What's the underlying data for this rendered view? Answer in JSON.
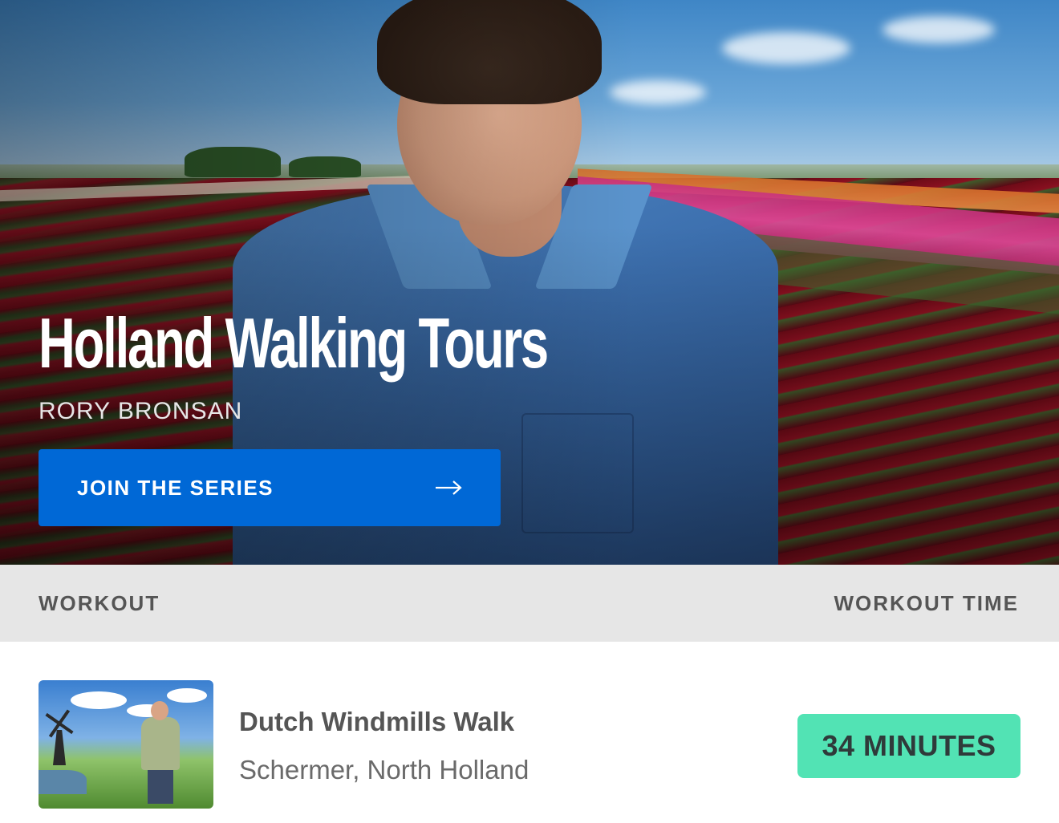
{
  "hero": {
    "title": "Holland Walking Tours",
    "author": "RORY BRONSAN",
    "cta_label": "JOIN THE SERIES",
    "cta_icon": "arrow-right-icon",
    "cta_color": "#0068d6"
  },
  "table": {
    "headers": {
      "workout": "WORKOUT",
      "workout_time": "WORKOUT TIME"
    },
    "rows": [
      {
        "title": "Dutch Windmills Walk",
        "location": "Schermer, North Holland",
        "duration": "34 MINUTES",
        "badge_color": "#52e3b4"
      }
    ]
  }
}
